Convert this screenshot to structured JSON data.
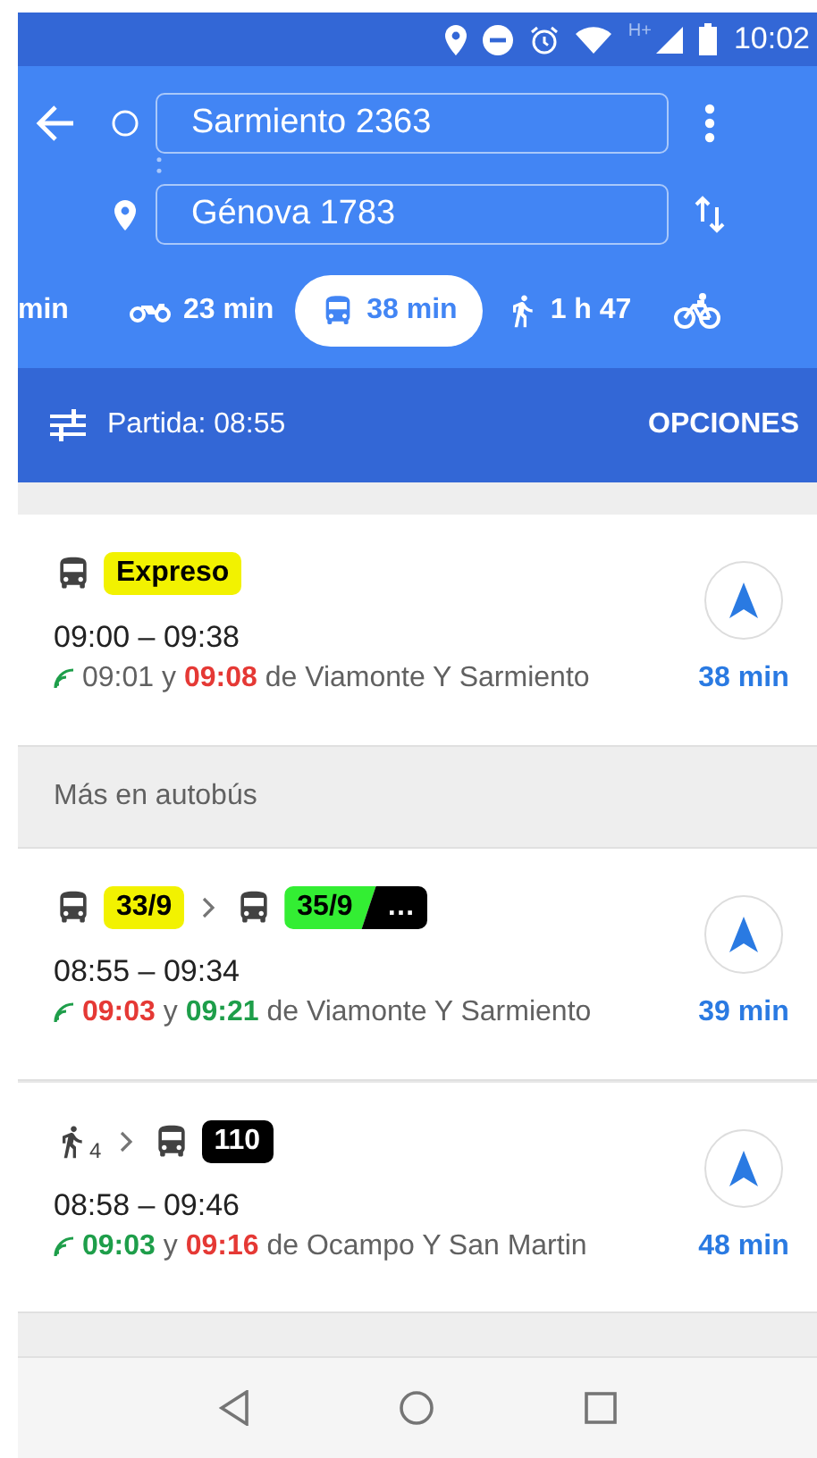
{
  "status_bar": {
    "network": "H+",
    "time": "10:02"
  },
  "header": {
    "origin": "Sarmiento 2363",
    "destination": "Génova 1783"
  },
  "modes": [
    {
      "kind": "partial",
      "label": "min",
      "selected": false
    },
    {
      "kind": "motorcycle",
      "label": "23 min",
      "selected": false
    },
    {
      "kind": "transit",
      "label": "38 min",
      "selected": true
    },
    {
      "kind": "walk",
      "label": "1 h 47",
      "selected": false
    },
    {
      "kind": "bike",
      "selected": false
    }
  ],
  "options_bar": {
    "departure": "Partida: 08:55",
    "button": "OPCIONES"
  },
  "fastest": [
    {
      "steps": [
        {
          "kind": "bus",
          "badges": [
            {
              "label": "Expreso",
              "color": "#f2f200"
            }
          ]
        }
      ],
      "times": "09:00 – 09:38",
      "departures": [
        {
          "time": "09:01",
          "color": "#616161"
        },
        {
          "time": "09:08",
          "color": "#e53935"
        }
      ],
      "joiner": "y",
      "stop": "de Viamonte Y Sarmiento",
      "duration": "38 min"
    }
  ],
  "section_title": "Más en autobús",
  "more_routes": [
    {
      "steps": [
        {
          "kind": "bus",
          "badges": [
            {
              "label": "33/9",
              "color": "#f2f200"
            }
          ]
        },
        {
          "kind": "bus",
          "badges": [
            {
              "label": "35/9",
              "color": "#33ee33"
            },
            {
              "label": "…",
              "color": "#000000"
            }
          ]
        }
      ],
      "times": "08:55 – 09:34",
      "departures": [
        {
          "time": "09:03",
          "color": "#e53935"
        },
        {
          "time": "09:21",
          "color": "#1e9e4a"
        }
      ],
      "joiner": "y",
      "stop": "de Viamonte Y Sarmiento",
      "duration": "39 min"
    },
    {
      "steps": [
        {
          "kind": "walk",
          "minutes": "4"
        },
        {
          "kind": "bus",
          "badges": [
            {
              "label": "110",
              "color": "#000000"
            }
          ]
        }
      ],
      "times": "08:58 – 09:46",
      "departures": [
        {
          "time": "09:03",
          "color": "#1e9e4a"
        },
        {
          "time": "09:16",
          "color": "#e53935"
        }
      ],
      "joiner": "y",
      "stop": "de Ocampo Y San Martin",
      "duration": "48 min"
    }
  ]
}
